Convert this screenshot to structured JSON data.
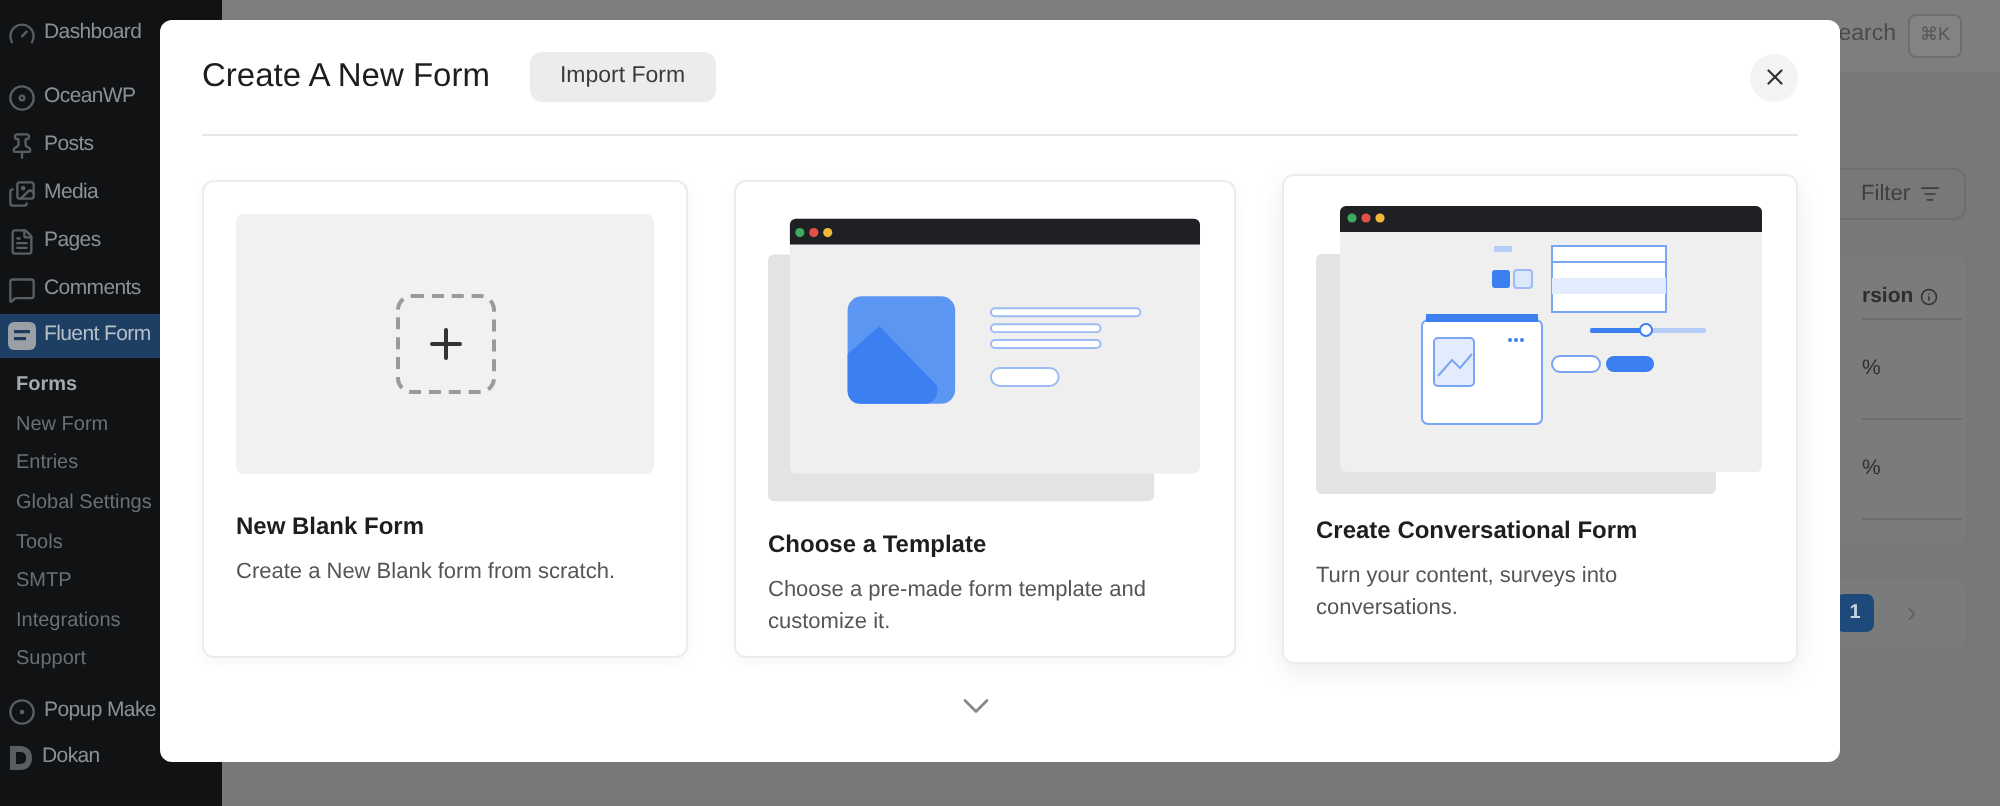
{
  "sidebar": {
    "items": [
      {
        "label": "Dashboard",
        "selected": false
      },
      {
        "label": "OceanWP",
        "selected": false
      },
      {
        "label": "Posts",
        "selected": false
      },
      {
        "label": "Media",
        "selected": false
      },
      {
        "label": "Pages",
        "selected": false
      },
      {
        "label": "Comments",
        "selected": false
      },
      {
        "label": "Fluent Form",
        "selected": true
      }
    ],
    "submenu": [
      {
        "label": "Forms",
        "selected": true
      },
      {
        "label": "New Form",
        "selected": false
      },
      {
        "label": "Entries",
        "selected": false
      },
      {
        "label": "Global Settings",
        "selected": false
      },
      {
        "label": "Tools",
        "selected": false
      },
      {
        "label": "SMTP",
        "selected": false
      },
      {
        "label": "Integrations",
        "selected": false
      },
      {
        "label": "Support",
        "selected": false
      }
    ],
    "bottom_items": [
      {
        "label": "Popup Make",
        "selected": false
      },
      {
        "label": "Dokan",
        "selected": false
      }
    ]
  },
  "background": {
    "search_text": "earch",
    "shortcut": "⌘K",
    "filter_button": "Filter",
    "column_header": "rsion",
    "cells": [
      "%",
      "%"
    ],
    "page": "1"
  },
  "modal": {
    "title": "Create A New Form",
    "import_button": "Import Form",
    "options": [
      {
        "kind": "blank",
        "title": "New Blank Form",
        "description": "Create a New Blank form from scratch."
      },
      {
        "kind": "template",
        "title": "Choose a Template",
        "description": "Choose a pre-made form template and customize it."
      },
      {
        "kind": "conversational",
        "title": "Create Conversational Form",
        "description": "Turn your content, surveys into conversations."
      }
    ]
  }
}
